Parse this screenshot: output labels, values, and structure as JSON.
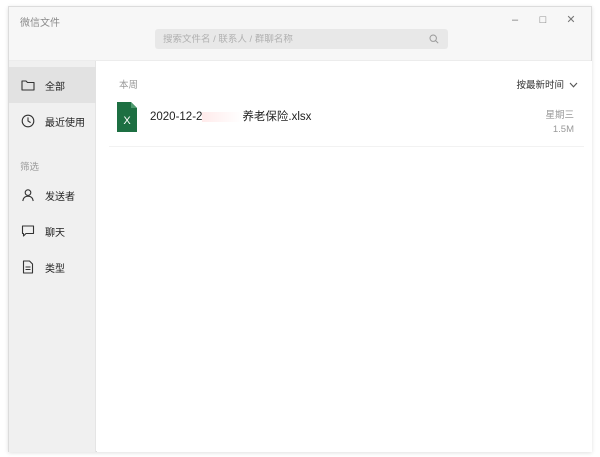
{
  "window": {
    "title": "微信文件",
    "controls": {
      "minimize": "–",
      "maximize": "□",
      "close": "✕"
    }
  },
  "search": {
    "placeholder": "搜索文件名 / 联系人 / 群聊名称",
    "value": ""
  },
  "sidebar": {
    "items": [
      {
        "label": "全部",
        "icon": "folder-icon",
        "active": true
      },
      {
        "label": "最近使用",
        "icon": "clock-icon",
        "active": false
      }
    ],
    "filter_section_label": "筛选",
    "filters": [
      {
        "label": "发送者",
        "icon": "person-icon"
      },
      {
        "label": "聊天",
        "icon": "chat-bubble-icon"
      },
      {
        "label": "类型",
        "icon": "document-icon"
      }
    ]
  },
  "main": {
    "group_label": "本周",
    "sort_label": "按最新时间",
    "files": [
      {
        "name_prefix": "2020-12-2",
        "name_suffix": "养老保险.xlsx",
        "icon_letter": "X",
        "day": "星期三",
        "size": "1.5M"
      }
    ]
  },
  "colors": {
    "excel_green": "#1d6f42",
    "sidebar_bg": "#f0f0f0",
    "sidebar_active_bg": "#e2e2e2"
  }
}
